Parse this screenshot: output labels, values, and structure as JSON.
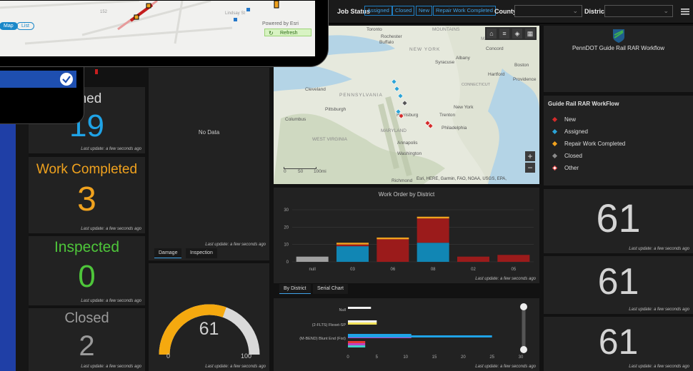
{
  "tablet": {
    "map_btn": "Map",
    "list_btn": "List",
    "powered_by": "Powered by Esri",
    "refresh_btn": "Refresh"
  },
  "filters": {
    "job_status_label": "Job Status",
    "status_chips": [
      "Assigned",
      "Closed",
      "New",
      "Repair Work Completed"
    ],
    "county_label": "County",
    "district_label": "District"
  },
  "stats": {
    "assigned": {
      "label": "Assigned",
      "label_visible": "gned",
      "value": "19",
      "color": "#1fa3e6"
    },
    "work_completed": {
      "label": "Work Completed",
      "value": "3",
      "color": "#f0a21e"
    },
    "inspected": {
      "label": "Inspected",
      "value": "0",
      "color": "#4ec63a"
    },
    "closed": {
      "label": "Closed",
      "value": "2",
      "color": "#9a9a9a"
    }
  },
  "last_update": "Last update: a few seconds ago",
  "no_data": "No Data",
  "damage_tabs": [
    "Damage",
    "Inspection"
  ],
  "gauge": {
    "value": "61",
    "min": "0",
    "max": "100",
    "fraction": 0.61
  },
  "brand": {
    "title": "PennDOT Guide Rail RAR Workflow"
  },
  "legend": {
    "title": "Guide Rail RAR WorkFlow",
    "items": [
      {
        "label": "New",
        "color": "#d42b2b"
      },
      {
        "label": "Assigned",
        "color": "#2ba3d6"
      },
      {
        "label": "Repair Work Completed",
        "color": "#f0a21e"
      },
      {
        "label": "Closed",
        "color": "#8a8a8a"
      },
      {
        "label": "Other",
        "color": "#e63535"
      }
    ]
  },
  "counts": [
    "61",
    "61",
    "61"
  ],
  "map": {
    "labels": [
      "Toronto",
      "Rochester",
      "Buffalo",
      "NEW YORK",
      "Albany",
      "Concord",
      "Syracuse",
      "Boston",
      "Providence",
      "Cleveland",
      "PENNSYLVANIA",
      "Pittsburgh",
      "Columbus",
      "WEST VIRGINIA",
      "Annapolis",
      "Washington",
      "Trenton",
      "New York",
      "Philadelphia",
      "MARYLAND",
      "Richmond",
      "CONNECTICUT",
      "Hartford",
      "MAINE",
      "MOUNTAINS",
      "Harrisburg"
    ],
    "attribution": "Esri, HERE, Garmin, FAO, NOAA, USGS, EPA,",
    "scale": [
      "0",
      "50",
      "100mi"
    ]
  },
  "chart_tabs": [
    "By District",
    "Serial Chart"
  ],
  "chart_data": [
    {
      "type": "bar",
      "title": "Work Order by District",
      "categories": [
        "null",
        "03",
        "06",
        "08",
        "02",
        "05"
      ],
      "ylim": [
        0,
        30
      ],
      "yticks": [
        0,
        10,
        20,
        30
      ],
      "series": [
        {
          "color": "#a0a0a0",
          "values": [
            3,
            0,
            0,
            0,
            0,
            0
          ]
        },
        {
          "color": "#1186b4",
          "values": [
            0,
            9,
            0,
            11,
            0,
            0
          ]
        },
        {
          "color": "#9b1b1b",
          "values": [
            0,
            1,
            13,
            14,
            3,
            4
          ]
        },
        {
          "color": "#f0a21e",
          "values": [
            0,
            1,
            1,
            1,
            0,
            0
          ]
        }
      ]
    },
    {
      "type": "bar",
      "orientation": "horizontal",
      "categories": [
        "Null",
        "(2-FLTS) Flexet-SP",
        "(M-BEND) Blunt End (Fist)"
      ],
      "xlim": [
        0,
        30
      ],
      "xticks": [
        0,
        5,
        10,
        15,
        20,
        25,
        30
      ],
      "values": [
        4,
        5,
        25
      ]
    }
  ]
}
